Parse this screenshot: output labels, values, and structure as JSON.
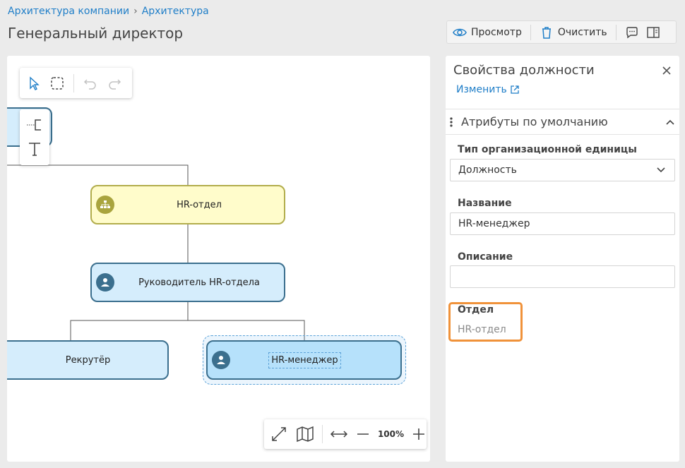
{
  "breadcrumb": {
    "item1": "Архитектура компании",
    "item2": "Архитектура"
  },
  "page_title": "Генеральный директор",
  "toolbar": {
    "view_label": "Просмотр",
    "clear_label": "Очистить"
  },
  "nodes": {
    "hr_dept": "HR-отдел",
    "hr_head": "Руководитель HR-отдела",
    "recruiter": "Рекрутёр",
    "hr_manager": "HR-менеджер"
  },
  "zoom": {
    "value": "100%"
  },
  "panel": {
    "title": "Свойства должности",
    "edit_link": "Изменить",
    "section_title": "Атрибуты по умолчанию",
    "fields": {
      "org_unit_type_label": "Тип организационной единицы",
      "org_unit_type_value": "Должность",
      "name_label": "Название",
      "name_value": "HR-менеджер",
      "description_label": "Описание",
      "description_value": "",
      "department_label": "Отдел",
      "department_value": "HR-отдел"
    }
  },
  "colors": {
    "accent": "#1f7ec8",
    "highlight": "#f0923a",
    "node_yellow": "#fffccb",
    "node_blue": "#d5edfc"
  }
}
